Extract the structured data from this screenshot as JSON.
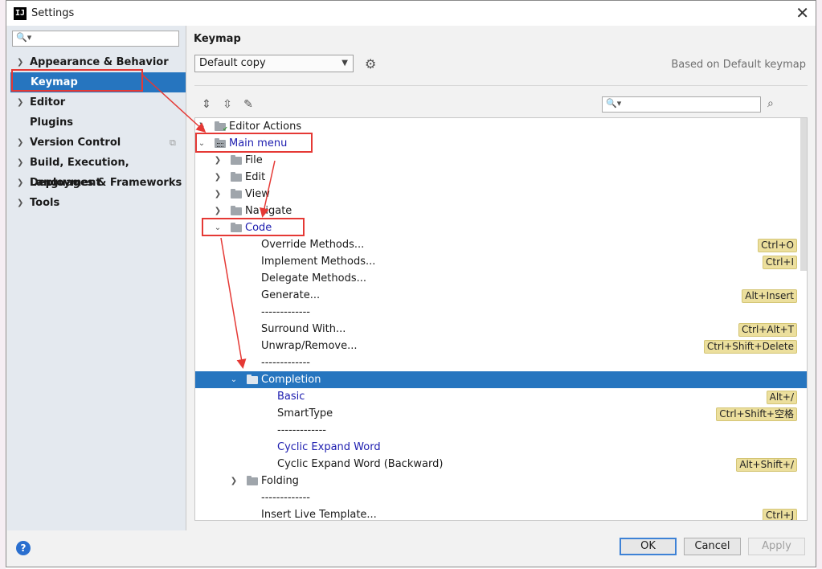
{
  "window": {
    "title": "Settings",
    "app_icon": "IJ"
  },
  "sidebar": {
    "search_placeholder": "",
    "items": [
      {
        "label": "Appearance & Behavior",
        "expandable": true
      },
      {
        "label": "Keymap",
        "expandable": false,
        "selected": true
      },
      {
        "label": "Editor",
        "expandable": true
      },
      {
        "label": "Plugins",
        "expandable": false
      },
      {
        "label": "Version Control",
        "expandable": true
      },
      {
        "label": "Build, Execution, Deployment",
        "expandable": true
      },
      {
        "label": "Languages & Frameworks",
        "expandable": true
      },
      {
        "label": "Tools",
        "expandable": true
      }
    ]
  },
  "main": {
    "title": "Keymap",
    "keymap_selected": "Default copy",
    "based_on": "Based on Default keymap",
    "search_placeholder": ""
  },
  "tree": [
    {
      "label": "Editor Actions",
      "shortcut": ""
    },
    {
      "label": "Main menu",
      "shortcut": ""
    },
    {
      "label": "File",
      "shortcut": ""
    },
    {
      "label": "Edit",
      "shortcut": ""
    },
    {
      "label": "View",
      "shortcut": ""
    },
    {
      "label": "Navigate",
      "shortcut": ""
    },
    {
      "label": "Code",
      "shortcut": ""
    },
    {
      "label": "Override Methods...",
      "shortcut": "Ctrl+O"
    },
    {
      "label": "Implement Methods...",
      "shortcut": "Ctrl+I"
    },
    {
      "label": "Delegate Methods...",
      "shortcut": ""
    },
    {
      "label": "Generate...",
      "shortcut": "Alt+Insert"
    },
    {
      "label": "-------------",
      "shortcut": ""
    },
    {
      "label": "Surround With...",
      "shortcut": "Ctrl+Alt+T"
    },
    {
      "label": "Unwrap/Remove...",
      "shortcut": "Ctrl+Shift+Delete"
    },
    {
      "label": "-------------",
      "shortcut": ""
    },
    {
      "label": "Completion",
      "shortcut": ""
    },
    {
      "label": "Basic",
      "shortcut": "Alt+/"
    },
    {
      "label": "SmartType",
      "shortcut": "Ctrl+Shift+空格"
    },
    {
      "label": "-------------",
      "shortcut": ""
    },
    {
      "label": "Cyclic Expand Word",
      "shortcut": ""
    },
    {
      "label": "Cyclic Expand Word (Backward)",
      "shortcut": "Alt+Shift+/"
    },
    {
      "label": "Folding",
      "shortcut": ""
    },
    {
      "label": "-------------",
      "shortcut": ""
    },
    {
      "label": "Insert Live Template...",
      "shortcut": "Ctrl+J"
    }
  ],
  "footer": {
    "ok": "OK",
    "cancel": "Cancel",
    "apply": "Apply",
    "help": "?"
  },
  "colors": {
    "selection": "#2675bf",
    "shortcut_bg": "#ecdf9d",
    "annotation": "#e53935",
    "link_blue": "#1c1caf"
  }
}
